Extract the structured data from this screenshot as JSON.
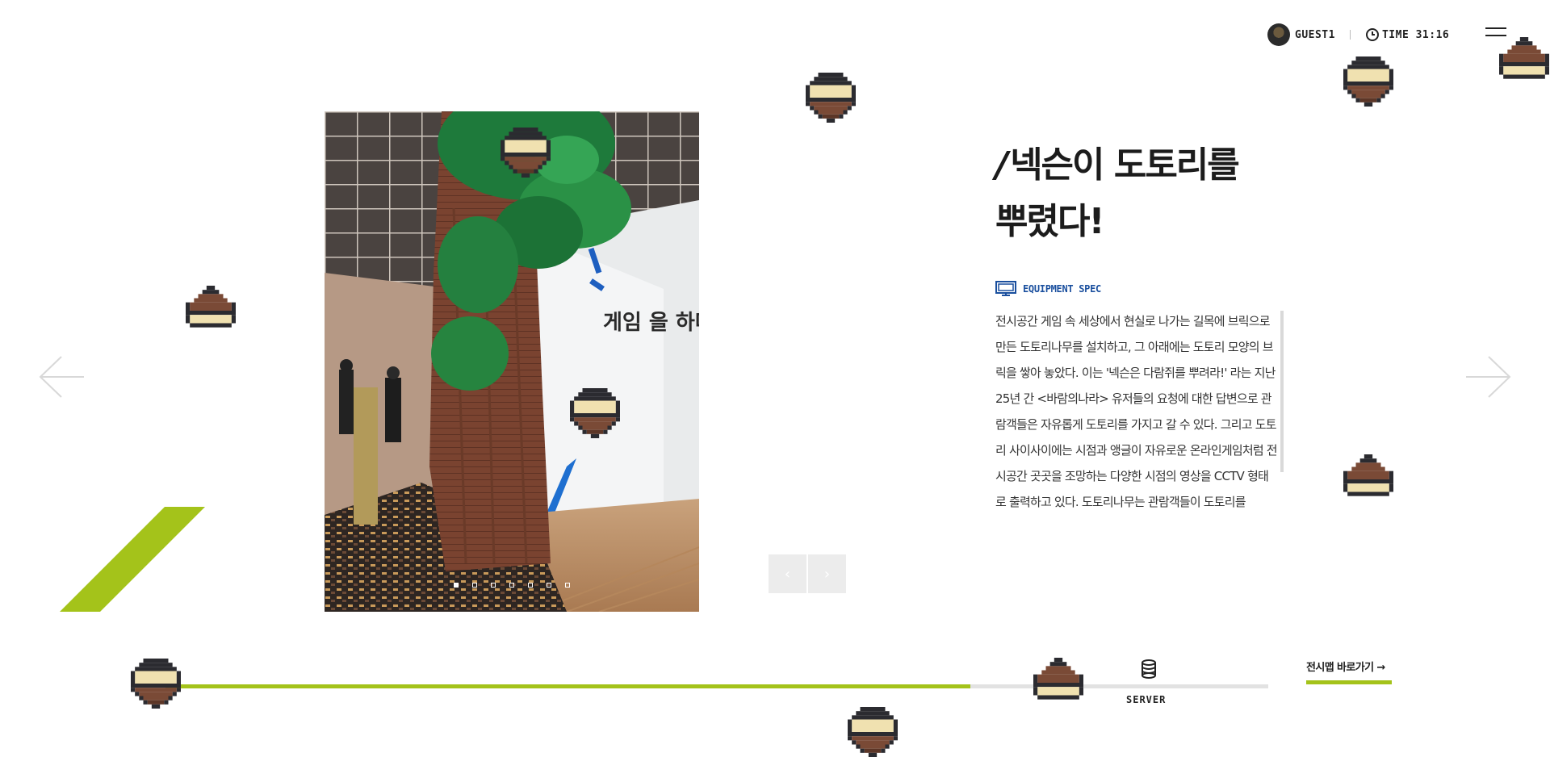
{
  "header": {
    "user_name": "GUEST1",
    "time_label": "TIME 31:16"
  },
  "exhibit": {
    "title_line1": "넥슨이 도토리를",
    "title_line2": "뿌렸다!",
    "spec_label": "EQUIPMENT SPEC",
    "description": "전시공간 게임 속 세상에서 현실로 나가는 길목에 브릭으로 만든 도토리나무를 설치하고, 그 아래에는 도토리 모양의 브릭을 쌓아 놓았다. 이는 '넥슨은 다람쥐를 뿌려라!' 라는 지난 25년 간 <바람의나라> 유저들의 요청에 대한 답변으로 관람객들은 자유롭게 도토리를 가지고 갈 수 있다. 그리고 도토리 사이사이에는 시점과 앵글이 자유로운 온라인게임처럼 전시공간 곳곳을 조망하는 다양한 시점의 영상을 CCTV 형태로 출력하고 있다. 도토리나무는 관람객들이 도토리를",
    "photo_wall_text": "게임 을 하다",
    "slides_total": 7,
    "slide_active": 1
  },
  "progress": {
    "percent": 73,
    "stage_label": "SERVER",
    "map_link": "전시맵 바로가기 →"
  },
  "colors": {
    "accent_green": "#a4c31a",
    "spec_blue": "#1a4f9e",
    "acorn_cap": "#2a2a2e",
    "acorn_top": "#f0e1b0",
    "acorn_body": "#7a4a36"
  },
  "icons": [
    "user-avatar",
    "clock-icon",
    "menu-icon",
    "arrow-left-icon",
    "arrow-right-icon",
    "computer-icon",
    "server-icon",
    "acorn-icon"
  ]
}
